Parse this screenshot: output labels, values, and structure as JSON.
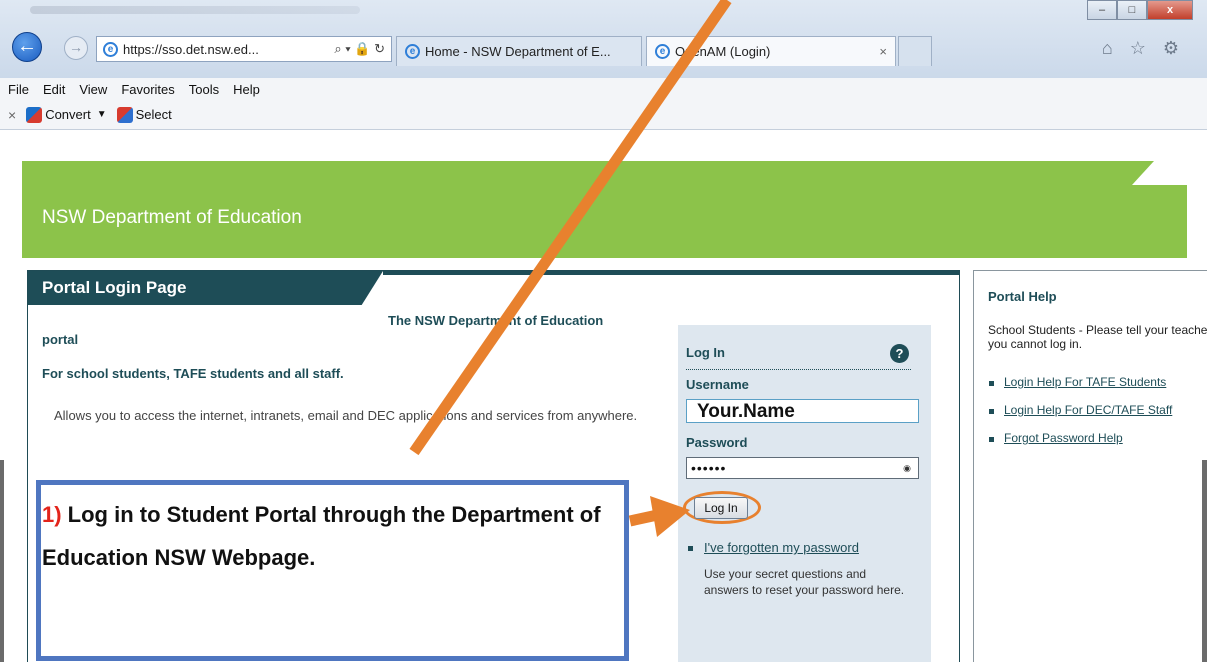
{
  "browser": {
    "address_url": "https://sso.det.nsw.ed...",
    "address_icons": "⌕ ▾ 🔒 ↻",
    "tabs": [
      {
        "label": "Home - NSW Department of E..."
      },
      {
        "label": "OpenAM (Login)"
      }
    ],
    "window_controls": {
      "minimize": "–",
      "maximize": "□",
      "close": "x"
    },
    "toolbar_icons": "⌂ ☆ ⚙"
  },
  "menubar": {
    "items": [
      "File",
      "Edit",
      "View",
      "Favorites",
      "Tools",
      "Help"
    ]
  },
  "commandbar": {
    "close_glyph": "×",
    "convert_label": "Convert",
    "select_label": "Select"
  },
  "page": {
    "banner_title": "NSW Department of Education",
    "login_box": {
      "title": "Portal Login Page",
      "dept_line": "The NSW Department of Education",
      "portal_word": "portal",
      "audience": "For school students, TAFE students and all staff.",
      "description": "Allows you to access the internet, intranets, email and DEC applications and services from anywhere."
    },
    "login_panel": {
      "title": "Log In",
      "help_glyph": "?",
      "username_label": "Username",
      "username_value": "Your.Name",
      "password_label": "Password",
      "password_value": "••••••",
      "login_button": "Log In",
      "forgot_link": "I've forgotten my password",
      "forgot_desc": "Use your secret questions and answers to reset your password here."
    },
    "help": {
      "title": "Portal Help",
      "text": "School Students - Please tell your teacher if you cannot log in.",
      "links": [
        "Login Help For TAFE Students",
        "Login Help For DEC/TAFE Staff",
        "Forgot Password Help"
      ]
    }
  },
  "annotation": {
    "number": "1)",
    "text": " Log in to Student Portal through the Department of Education NSW Webpage.",
    "accent_color": "#e8812e",
    "box_color": "#4f76c0"
  }
}
